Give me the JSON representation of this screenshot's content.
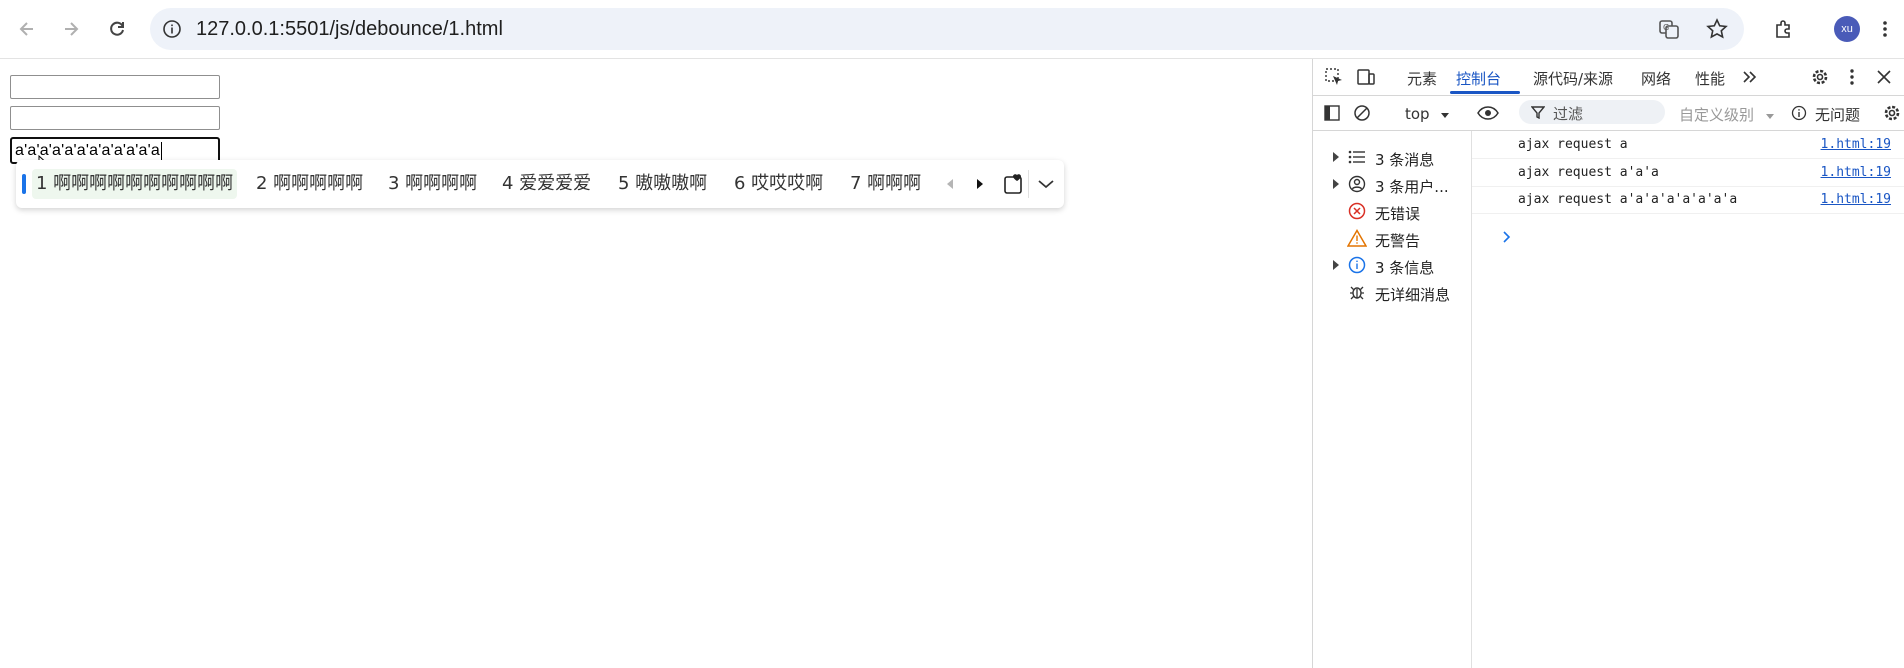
{
  "browser": {
    "url": "127.0.0.1:5501/js/debounce/1.html",
    "avatar_initials": "xu",
    "icons": [
      "back-icon",
      "forward-icon",
      "reload-icon",
      "site-info-icon",
      "translate-icon",
      "bookmark-star-icon",
      "extensions-icon",
      "menu-icon"
    ]
  },
  "page": {
    "input1_value": "",
    "input2_value": "",
    "input3_value": "a'a'a'a'a'a'a'a'a'a'a'a"
  },
  "ime": {
    "candidates": [
      "1 啊啊啊啊啊啊啊啊啊啊",
      "2 啊啊啊啊啊",
      "3 啊啊啊啊",
      "4 爱爱爱爱",
      "5 嗷嗷嗷啊",
      "6 哎哎哎啊",
      "7 啊啊啊"
    ],
    "selected_index": 0
  },
  "devtools": {
    "tabs": [
      "元素",
      "控制台",
      "源代码/来源",
      "网络",
      "性能"
    ],
    "active_tab": "控制台",
    "context": "top",
    "filter_placeholder": "过滤",
    "levels_label": "自定义级别",
    "issues_label": "无问题",
    "sidebar": [
      {
        "label": "3 条消息",
        "icon": "list-icon",
        "expandable": true
      },
      {
        "label": "3 条用户...",
        "icon": "user-icon",
        "expandable": true
      },
      {
        "label": "无错误",
        "icon": "error-icon",
        "expandable": false
      },
      {
        "label": "无警告",
        "icon": "warning-icon",
        "expandable": false
      },
      {
        "label": "3 条信息",
        "icon": "info-icon",
        "expandable": true
      },
      {
        "label": "无详细消息",
        "icon": "bug-icon",
        "expandable": false
      }
    ],
    "logs": [
      {
        "message": "ajax request a",
        "source": "1.html:19"
      },
      {
        "message": "ajax request a'a'a",
        "source": "1.html:19"
      },
      {
        "message": "ajax request a'a'a'a'a'a'a'a",
        "source": "1.html:19"
      }
    ],
    "colors": {
      "accent": "#1a56c4",
      "error": "#d93025",
      "warning": "#e37400",
      "info": "#1a73e8"
    }
  }
}
